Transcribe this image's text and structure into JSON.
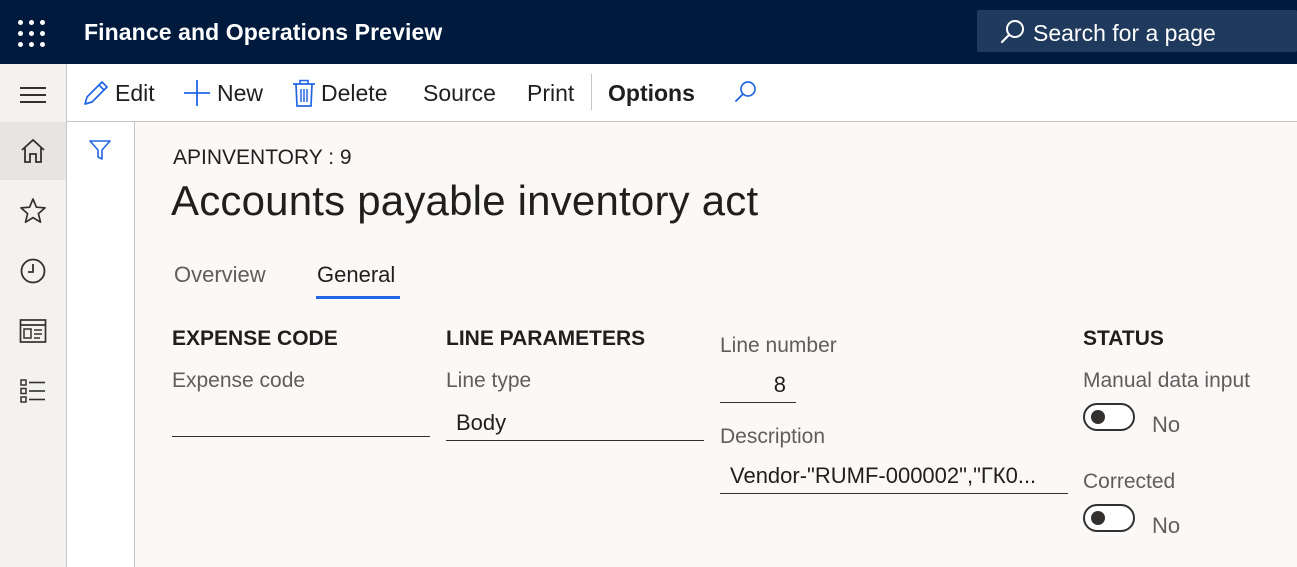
{
  "app": {
    "title": "Finance and Operations Preview",
    "search_placeholder": "Search for a page"
  },
  "nav": {
    "icons": [
      "hamburger-icon",
      "home-icon",
      "star-icon",
      "clock-icon",
      "workspace-icon",
      "list-icon"
    ]
  },
  "actions": {
    "edit": "Edit",
    "new": "New",
    "delete": "Delete",
    "source": "Source",
    "print": "Print",
    "options": "Options"
  },
  "page": {
    "caption": "APINVENTORY : 9",
    "title": "Accounts payable inventory act",
    "tabs": [
      {
        "label": "Overview",
        "active": false
      },
      {
        "label": "General",
        "active": true
      }
    ]
  },
  "groups": {
    "expense": {
      "heading": "EXPENSE CODE",
      "expense_code_label": "Expense code",
      "expense_code_value": ""
    },
    "line_parameters": {
      "heading": "LINE PARAMETERS",
      "line_type_label": "Line type",
      "line_type_value": "Body",
      "line_number_label": "Line number",
      "line_number_value": "8",
      "description_label": "Description",
      "description_value": "Vendor-\"RUMF-000002\",\"ГК0..."
    },
    "status": {
      "heading": "STATUS",
      "manual_label": "Manual data input",
      "manual_value": "No",
      "manual_on": false,
      "corrected_label": "Corrected",
      "corrected_value": "No",
      "corrected_on": false
    }
  },
  "colors": {
    "topbar": "#001a3d",
    "accent": "#2266e3",
    "background": "#faf9f8"
  }
}
